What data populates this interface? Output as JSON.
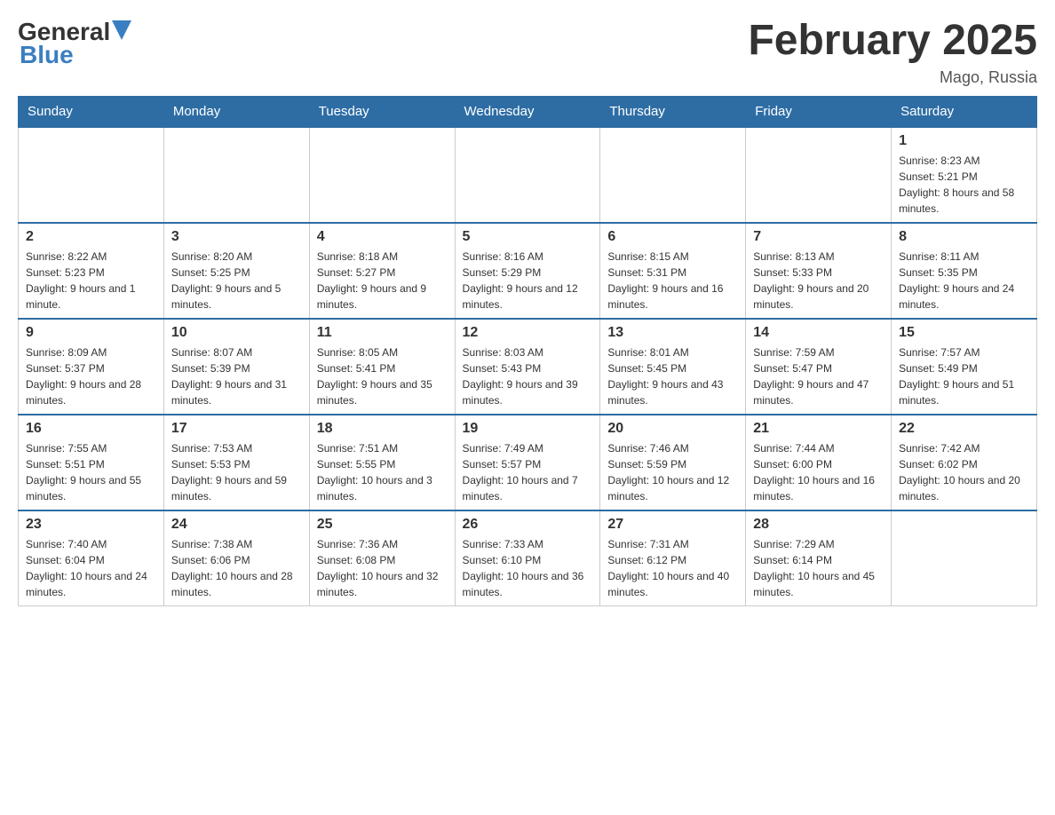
{
  "logo": {
    "general": "General",
    "blue": "Blue"
  },
  "title": "February 2025",
  "location": "Mago, Russia",
  "days_of_week": [
    "Sunday",
    "Monday",
    "Tuesday",
    "Wednesday",
    "Thursday",
    "Friday",
    "Saturday"
  ],
  "weeks": [
    [
      {
        "day": "",
        "info": ""
      },
      {
        "day": "",
        "info": ""
      },
      {
        "day": "",
        "info": ""
      },
      {
        "day": "",
        "info": ""
      },
      {
        "day": "",
        "info": ""
      },
      {
        "day": "",
        "info": ""
      },
      {
        "day": "1",
        "info": "Sunrise: 8:23 AM\nSunset: 5:21 PM\nDaylight: 8 hours and 58 minutes."
      }
    ],
    [
      {
        "day": "2",
        "info": "Sunrise: 8:22 AM\nSunset: 5:23 PM\nDaylight: 9 hours and 1 minute."
      },
      {
        "day": "3",
        "info": "Sunrise: 8:20 AM\nSunset: 5:25 PM\nDaylight: 9 hours and 5 minutes."
      },
      {
        "day": "4",
        "info": "Sunrise: 8:18 AM\nSunset: 5:27 PM\nDaylight: 9 hours and 9 minutes."
      },
      {
        "day": "5",
        "info": "Sunrise: 8:16 AM\nSunset: 5:29 PM\nDaylight: 9 hours and 12 minutes."
      },
      {
        "day": "6",
        "info": "Sunrise: 8:15 AM\nSunset: 5:31 PM\nDaylight: 9 hours and 16 minutes."
      },
      {
        "day": "7",
        "info": "Sunrise: 8:13 AM\nSunset: 5:33 PM\nDaylight: 9 hours and 20 minutes."
      },
      {
        "day": "8",
        "info": "Sunrise: 8:11 AM\nSunset: 5:35 PM\nDaylight: 9 hours and 24 minutes."
      }
    ],
    [
      {
        "day": "9",
        "info": "Sunrise: 8:09 AM\nSunset: 5:37 PM\nDaylight: 9 hours and 28 minutes."
      },
      {
        "day": "10",
        "info": "Sunrise: 8:07 AM\nSunset: 5:39 PM\nDaylight: 9 hours and 31 minutes."
      },
      {
        "day": "11",
        "info": "Sunrise: 8:05 AM\nSunset: 5:41 PM\nDaylight: 9 hours and 35 minutes."
      },
      {
        "day": "12",
        "info": "Sunrise: 8:03 AM\nSunset: 5:43 PM\nDaylight: 9 hours and 39 minutes."
      },
      {
        "day": "13",
        "info": "Sunrise: 8:01 AM\nSunset: 5:45 PM\nDaylight: 9 hours and 43 minutes."
      },
      {
        "day": "14",
        "info": "Sunrise: 7:59 AM\nSunset: 5:47 PM\nDaylight: 9 hours and 47 minutes."
      },
      {
        "day": "15",
        "info": "Sunrise: 7:57 AM\nSunset: 5:49 PM\nDaylight: 9 hours and 51 minutes."
      }
    ],
    [
      {
        "day": "16",
        "info": "Sunrise: 7:55 AM\nSunset: 5:51 PM\nDaylight: 9 hours and 55 minutes."
      },
      {
        "day": "17",
        "info": "Sunrise: 7:53 AM\nSunset: 5:53 PM\nDaylight: 9 hours and 59 minutes."
      },
      {
        "day": "18",
        "info": "Sunrise: 7:51 AM\nSunset: 5:55 PM\nDaylight: 10 hours and 3 minutes."
      },
      {
        "day": "19",
        "info": "Sunrise: 7:49 AM\nSunset: 5:57 PM\nDaylight: 10 hours and 7 minutes."
      },
      {
        "day": "20",
        "info": "Sunrise: 7:46 AM\nSunset: 5:59 PM\nDaylight: 10 hours and 12 minutes."
      },
      {
        "day": "21",
        "info": "Sunrise: 7:44 AM\nSunset: 6:00 PM\nDaylight: 10 hours and 16 minutes."
      },
      {
        "day": "22",
        "info": "Sunrise: 7:42 AM\nSunset: 6:02 PM\nDaylight: 10 hours and 20 minutes."
      }
    ],
    [
      {
        "day": "23",
        "info": "Sunrise: 7:40 AM\nSunset: 6:04 PM\nDaylight: 10 hours and 24 minutes."
      },
      {
        "day": "24",
        "info": "Sunrise: 7:38 AM\nSunset: 6:06 PM\nDaylight: 10 hours and 28 minutes."
      },
      {
        "day": "25",
        "info": "Sunrise: 7:36 AM\nSunset: 6:08 PM\nDaylight: 10 hours and 32 minutes."
      },
      {
        "day": "26",
        "info": "Sunrise: 7:33 AM\nSunset: 6:10 PM\nDaylight: 10 hours and 36 minutes."
      },
      {
        "day": "27",
        "info": "Sunrise: 7:31 AM\nSunset: 6:12 PM\nDaylight: 10 hours and 40 minutes."
      },
      {
        "day": "28",
        "info": "Sunrise: 7:29 AM\nSunset: 6:14 PM\nDaylight: 10 hours and 45 minutes."
      },
      {
        "day": "",
        "info": ""
      }
    ]
  ]
}
